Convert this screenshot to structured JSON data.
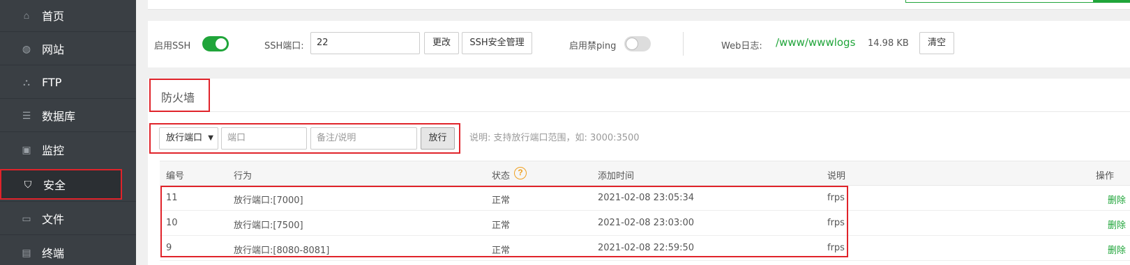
{
  "sidebar": {
    "items": [
      {
        "label": "首页",
        "icon": "home-icon",
        "glyph": "⌂"
      },
      {
        "label": "网站",
        "icon": "globe-icon",
        "glyph": "◍"
      },
      {
        "label": "FTP",
        "icon": "ftp-icon",
        "glyph": "⛬"
      },
      {
        "label": "数据库",
        "icon": "database-icon",
        "glyph": "☰"
      },
      {
        "label": "监控",
        "icon": "monitor-icon",
        "glyph": "▣"
      },
      {
        "label": "安全",
        "icon": "shield-icon",
        "glyph": "⛉",
        "active": true
      },
      {
        "label": "文件",
        "icon": "folder-icon",
        "glyph": "▭"
      },
      {
        "label": "终端",
        "icon": "terminal-icon",
        "glyph": "▤"
      }
    ]
  },
  "ssh": {
    "enable_ssh_label": "启用SSH",
    "enable_ssh_on": true,
    "port_label": "SSH端口:",
    "port_value": "22",
    "change_button": "更改",
    "security_button": "SSH安全管理",
    "ping_label": "启用禁ping",
    "ping_on": false,
    "weblog_label": "Web日志:",
    "weblog_path": "/www/wwwlogs",
    "weblog_size": "14.98 KB",
    "clear_button": "清空"
  },
  "firewall": {
    "title": "防火墙",
    "rule_type_selected": "放行端口",
    "port_placeholder": "端口",
    "note_placeholder": "备注/说明",
    "allow_button": "放行",
    "hint": "说明: 支持放行端口范围，如: 3000:3500"
  },
  "table": {
    "headers": {
      "id": "编号",
      "action": "行为",
      "status": "状态",
      "added": "添加时间",
      "note": "说明",
      "ops": "操作"
    },
    "status_help_glyph": "?",
    "rows": [
      {
        "id": "11",
        "action": "放行端口:[7000]",
        "status": "正常",
        "added": "2021-02-08 23:05:34",
        "note": "frps",
        "op": "删除"
      },
      {
        "id": "10",
        "action": "放行端口:[7500]",
        "status": "正常",
        "added": "2021-02-08 23:03:00",
        "note": "frps",
        "op": "删除"
      },
      {
        "id": "9",
        "action": "放行端口:[8080-8081]",
        "status": "正常",
        "added": "2021-02-08 22:59:50",
        "note": "frps",
        "op": "删除"
      }
    ]
  },
  "colors": {
    "accent": "#20a53a",
    "highlight": "#e0232a",
    "sidebar_bg": "#3a3f44"
  }
}
